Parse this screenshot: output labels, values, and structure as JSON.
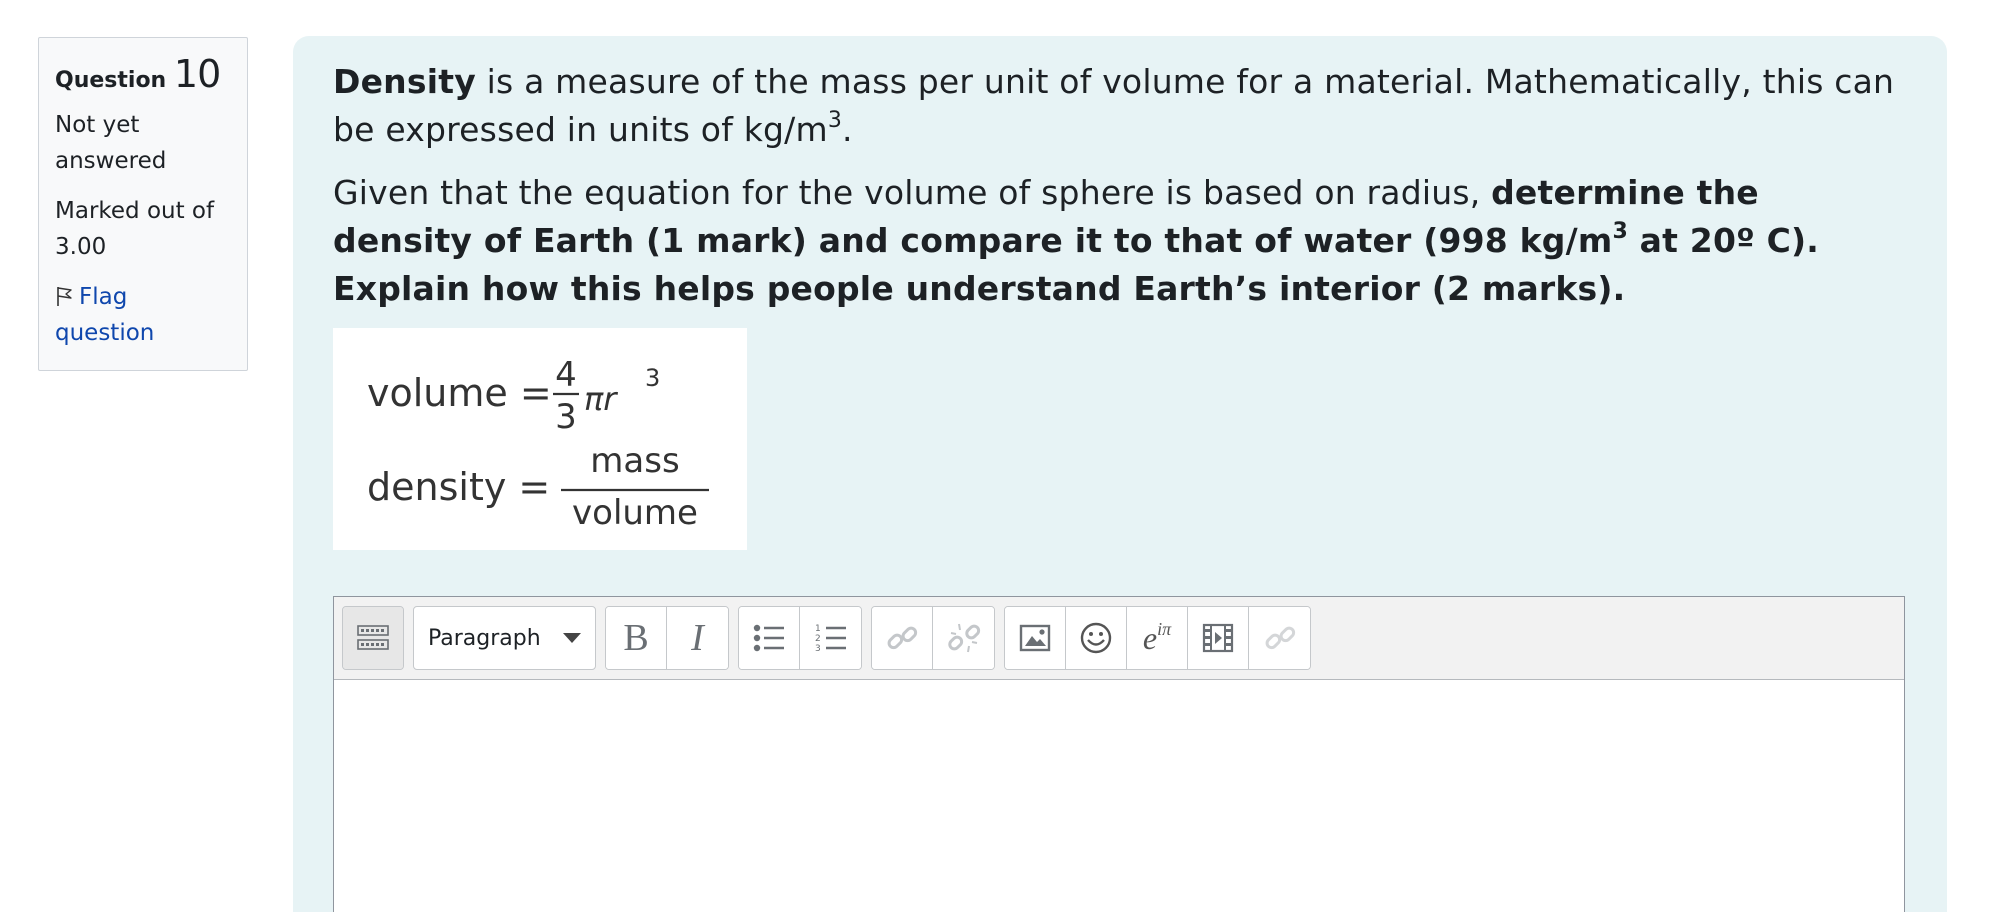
{
  "question_info": {
    "label": "Question",
    "number": "10",
    "state": "Not yet answered",
    "grade": "Marked out of 3.00",
    "flag_label": "Flag question"
  },
  "question_text": {
    "p1_bold": "Density",
    "p1_rest": " is a measure of the mass per unit of volume for a material. Mathematically, this can be expressed in units of kg/m",
    "p1_sup": "3",
    "p1_end": ".",
    "p2_plain": "Given that the equation for the volume of sphere is based on radius, ",
    "p2_bold_a": "determine the density of Earth (1 mark) and compare it to that of water (998 kg/m",
    "p2_sup": "3",
    "p2_bold_b": " at 20º C). Explain how this helps people understand Earth’s interior (2 marks)."
  },
  "formula_image": {
    "line1_label": "volume =",
    "line1_num": "4",
    "line1_den": "3",
    "line1_tail": "πr",
    "line1_exp": "3",
    "line2_label": "density =",
    "line2_num": "mass",
    "line2_den": "volume"
  },
  "editor": {
    "toolbar": {
      "paragraph_select": "Paragraph",
      "bold_label": "B",
      "italic_label": "I",
      "equation_label": "e",
      "equation_sup": "iπ",
      "icons": [
        "toolbar-toggle-icon",
        "chevron-down-icon",
        "unordered-list-icon",
        "ordered-list-icon",
        "link-icon",
        "unlink-icon",
        "image-icon",
        "emoji-icon",
        "equation-icon",
        "media-icon",
        "manage-files-icon"
      ]
    },
    "content": ""
  },
  "colors": {
    "content_bg": "#e7f3f5",
    "info_bg": "#f8f9fa",
    "link": "#0f47ad",
    "text": "#1d2125"
  }
}
